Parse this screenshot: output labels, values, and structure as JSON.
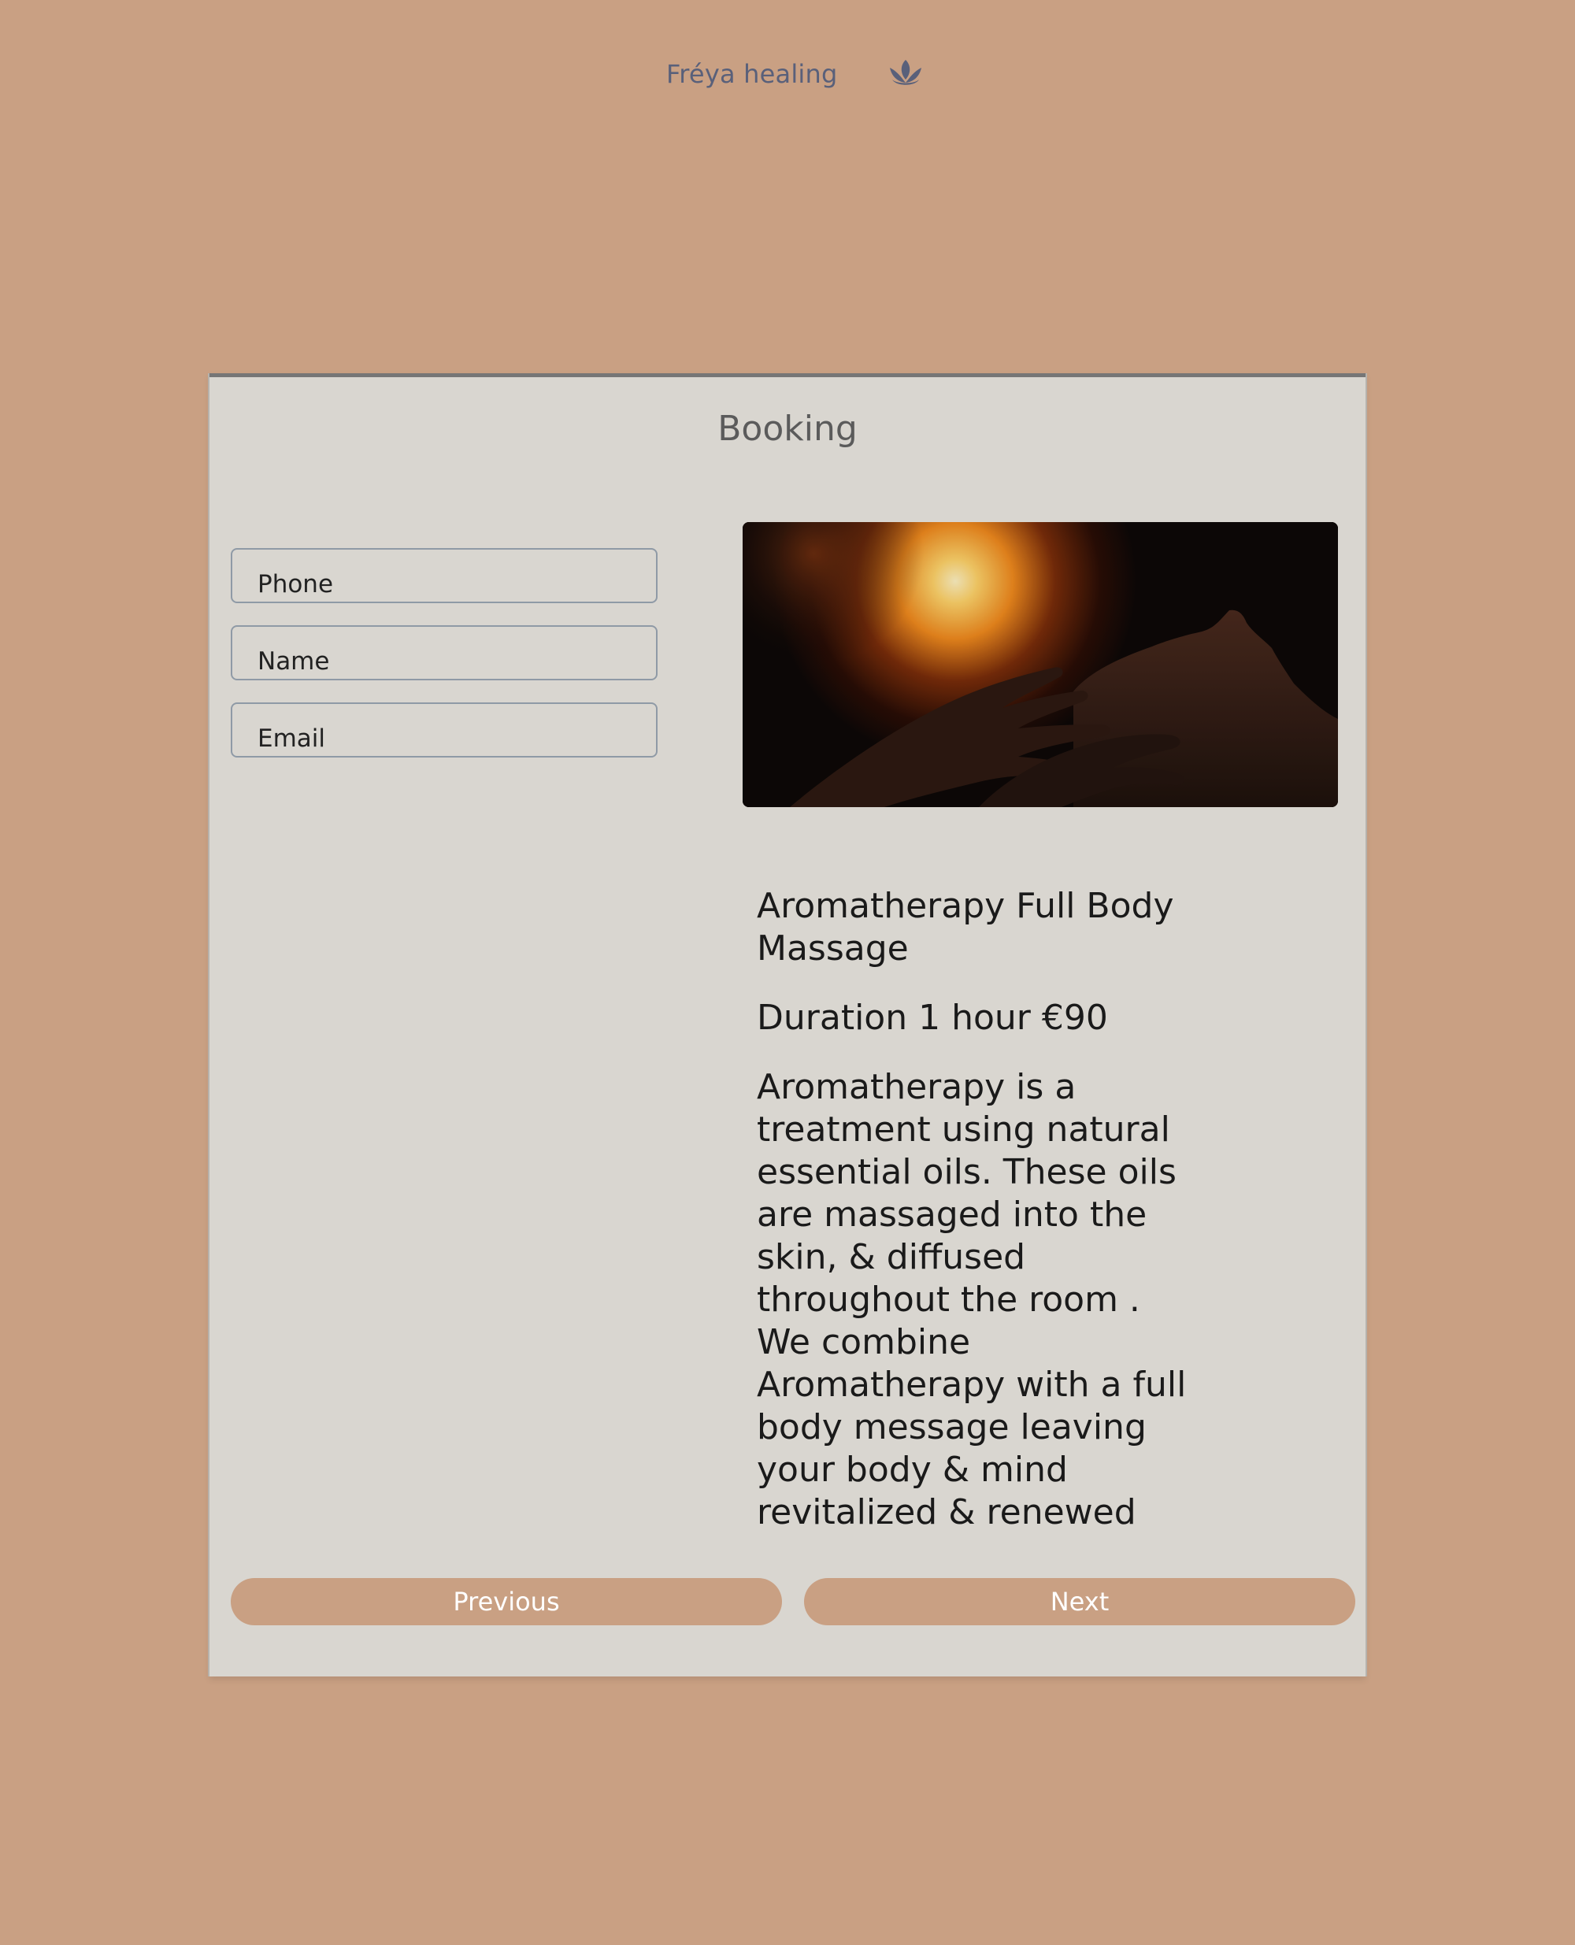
{
  "header": {
    "brand_name": "Fréya healing",
    "brand_icon": "lotus-icon",
    "brand_icon_color": "#59607a"
  },
  "booking": {
    "title": "Booking",
    "fields": {
      "phone_placeholder": "Phone",
      "name_placeholder": "Name",
      "email_placeholder": "Email"
    },
    "service": {
      "image_icon": "massage-photo",
      "title": "Aromatherapy Full Body Massage",
      "duration": "Duration 1 hour €90",
      "description": "Aromatherapy is a treatment using natural essential oils. These oils are massaged into the skin, & diffused throughout the room . We combine Aromatherapy with a full body message leaving your body & mind revitalized & renewed"
    },
    "buttons": {
      "previous": "Previous",
      "next": "Next"
    }
  },
  "colors": {
    "page_background": "#c9a083",
    "card_background": "#d9d6d0",
    "button_background": "#c9a083",
    "button_text": "#ffffff"
  }
}
